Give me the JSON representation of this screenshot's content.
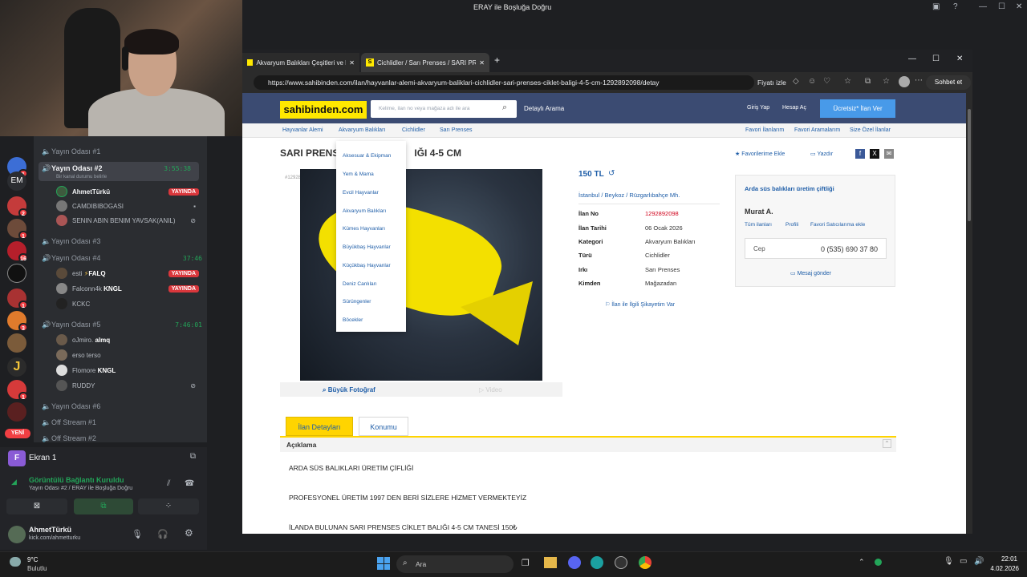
{
  "window_title": "ERAY ile Boşluğa Doğru",
  "discord": {
    "channels": [
      {
        "name": "Yayın Odası #1"
      },
      {
        "name": "Yayın Odası #2",
        "timer": "3:55:38",
        "subtitle": "Bir kanal durumu belirle"
      },
      {
        "name": "Yayın Odası #3"
      },
      {
        "name": "Yayın Odası #4",
        "timer": "37:46"
      },
      {
        "name": "Yayın Odası #5",
        "timer": "7:46:01"
      },
      {
        "name": "Yayın Odası #6"
      },
      {
        "name": "Off Stream #1"
      },
      {
        "name": "Off Stream #2"
      }
    ],
    "room2_users": [
      "AhmetTürkü",
      "CAMDIBIBOGASI",
      "SENIN ABIN BENIM YAVSAK(ANIL)"
    ],
    "room4_users": [
      "esti",
      "Falconn4k",
      "KCKC"
    ],
    "room5_users": [
      "oJmiro.",
      "erso terso",
      "Flomore",
      "RUDDY"
    ],
    "tags": {
      "falq": "FALQ",
      "kngl": "KNGL",
      "almq": "almq"
    },
    "live_label": "YAYINDA",
    "rail_em": "EM",
    "new_label": "YENİ",
    "screen_panel": {
      "title": "Ekran 1",
      "status": "Görüntülü Bağlantı Kuruldu",
      "sub": "Yayın Odası #2 / ERAY ile Boşluğa Doğru"
    },
    "user_panel": {
      "name": "AhmetTürkü",
      "sub": "kick.com/ahmetturku"
    }
  },
  "browser": {
    "tabs": [
      {
        "label": "Akvaryum Balıkları Çeşitleri ve Fiya"
      },
      {
        "label": "Cichlidler / Sarı Prenses / SARI PRE"
      }
    ],
    "url": "https://www.sahibinden.com/ilan/hayvanlar-alemi-akvaryum-baliklari-cichlidler-sari-prenses-ciklet-baligi-4-5-cm-1292892098/detay",
    "fiyati_izle": "Fiyatı izle",
    "sohbet": "Sohbet et"
  },
  "site": {
    "logo": "sahibinden.com",
    "search_placeholder": "Kelime, ilan no veya mağaza adı ile ara",
    "detayli": "Detaylı Arama",
    "giris": "Giriş Yap",
    "hesap": "Hesap Aç",
    "ilan_ver": "Ücretsiz* İlan Ver",
    "breadcrumb": [
      "Hayvanlar Alemi",
      "Akvaryum Balıkları",
      "Cichlidler",
      "Sarı Prenses"
    ],
    "right_links": [
      "Favori İlanlarım",
      "Favori Aramalarım",
      "Size Özel İlanlar"
    ],
    "title": "SARI PRENS",
    "title_end": "IĞI 4-5 CM",
    "favori_ekle": "Favorilerime Ekle",
    "yazdir": "Yazdır",
    "listing_no_label": "#1292892098",
    "menu": [
      "Aksesuar & Ekipman",
      "Yem & Mama",
      "Evcil Hayvanlar",
      "Akvaryum Balıkları",
      "Kümes Hayvanları",
      "Büyükbaş Hayvanlar",
      "Küçükbaş Hayvanlar",
      "Deniz Canlıları",
      "Sürüngenler",
      "Böcekler"
    ],
    "price": "150 TL",
    "location": [
      "İstanbul",
      "Beykoz",
      "Rüzgarlıbahçe Mh."
    ],
    "details": [
      {
        "k": "İlan No",
        "v": "1292892098"
      },
      {
        "k": "İlan Tarihi",
        "v": "06 Ocak 2026"
      },
      {
        "k": "Kategori",
        "v": "Akvaryum Balıkları"
      },
      {
        "k": "Türü",
        "v": "Cichlidler"
      },
      {
        "k": "Irkı",
        "v": "Sarı Prenses"
      },
      {
        "k": "Kimden",
        "v": "Mağazadan"
      }
    ],
    "complaint": "İlan ile İlgili Şikayetim Var",
    "big_photo": "Büyük Fotoğraf",
    "video": "Video",
    "seller": {
      "store": "Arda süs balıkları üretim çiftliği",
      "name": "Murat A.",
      "links": [
        "Tüm ilanları",
        "Profili",
        "Favori Satıcılarıma ekle"
      ],
      "phone_label": "Cep",
      "phone": "0 (535) 690 37 80",
      "message": "Mesaj gönder"
    },
    "tab_detail": "İlan Detayları",
    "tab_location": "Konumu",
    "desc_title": "Açıklama",
    "desc_lines": [
      "ARDA SÜS BALIKLARI ÜRETİM ÇİFLİĞİ",
      "PROFESYONEL ÜRETİM 1997 DEN BERİ SİZLERE HİZMET VERMEKTEYİZ",
      "İLANDA BULUNAN SARI PRENSES CİKLET BALIĞI 4-5 CM TANESİ 150₺"
    ]
  },
  "taskbar": {
    "weather_temp": "9°C",
    "weather_text": "Bulutlu",
    "search": "Ara",
    "time": "22:01",
    "date": "4.02.2026"
  }
}
